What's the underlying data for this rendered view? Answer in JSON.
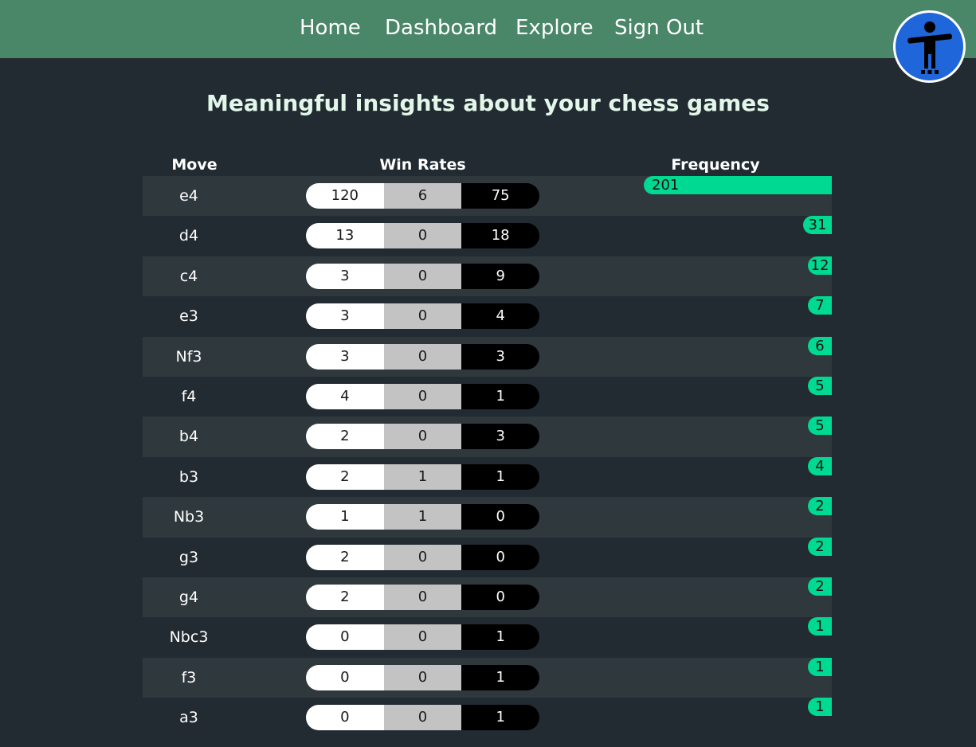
{
  "nav": {
    "links": [
      "Home",
      "Dashboard",
      "Explore",
      "Sign Out"
    ]
  },
  "accessibility": {
    "icon": "accessibility-person-icon",
    "color": "#1e66d9"
  },
  "title": "Meaningful insights about your chess games",
  "table": {
    "headers": {
      "move": "Move",
      "win_rates": "Win Rates",
      "frequency": "Frequency"
    },
    "colors": {
      "win": "#ffffff",
      "draw": "#c3c3c3",
      "loss": "#000000",
      "frequency": "#00d992"
    },
    "rows": [
      {
        "move": "e4",
        "win": "120",
        "draw": "6",
        "loss": "75",
        "frequency": "201"
      },
      {
        "move": "d4",
        "win": "13",
        "draw": "0",
        "loss": "18",
        "frequency": "31"
      },
      {
        "move": "c4",
        "win": "3",
        "draw": "0",
        "loss": "9",
        "frequency": "12"
      },
      {
        "move": "e3",
        "win": "3",
        "draw": "0",
        "loss": "4",
        "frequency": "7"
      },
      {
        "move": "Nf3",
        "win": "3",
        "draw": "0",
        "loss": "3",
        "frequency": "6"
      },
      {
        "move": "f4",
        "win": "4",
        "draw": "0",
        "loss": "1",
        "frequency": "5"
      },
      {
        "move": "b4",
        "win": "2",
        "draw": "0",
        "loss": "3",
        "frequency": "5"
      },
      {
        "move": "b3",
        "win": "2",
        "draw": "1",
        "loss": "1",
        "frequency": "4"
      },
      {
        "move": "Nb3",
        "win": "1",
        "draw": "1",
        "loss": "0",
        "frequency": "2"
      },
      {
        "move": "g3",
        "win": "2",
        "draw": "0",
        "loss": "0",
        "frequency": "2"
      },
      {
        "move": "g4",
        "win": "2",
        "draw": "0",
        "loss": "0",
        "frequency": "2"
      },
      {
        "move": "Nbc3",
        "win": "0",
        "draw": "0",
        "loss": "1",
        "frequency": "1"
      },
      {
        "move": "f3",
        "win": "0",
        "draw": "0",
        "loss": "1",
        "frequency": "1"
      },
      {
        "move": "a3",
        "win": "0",
        "draw": "0",
        "loss": "1",
        "frequency": "1"
      }
    ]
  }
}
